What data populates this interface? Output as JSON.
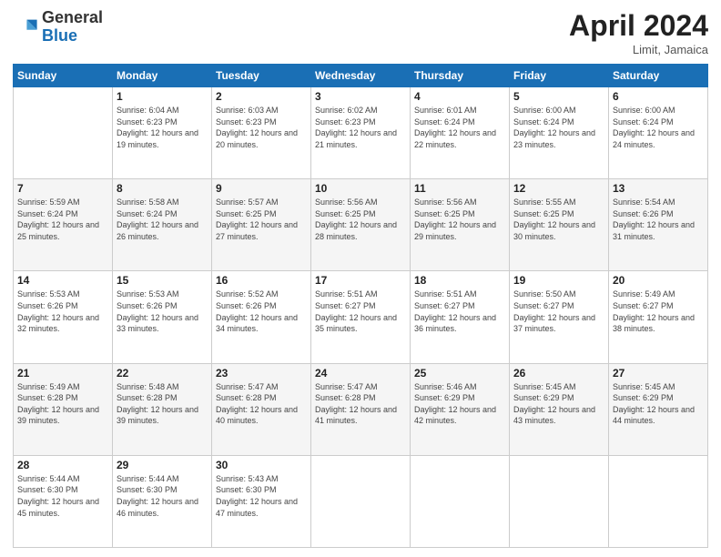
{
  "header": {
    "logo_general": "General",
    "logo_blue": "Blue",
    "month_title": "April 2024",
    "location": "Limit, Jamaica"
  },
  "weekdays": [
    "Sunday",
    "Monday",
    "Tuesday",
    "Wednesday",
    "Thursday",
    "Friday",
    "Saturday"
  ],
  "weeks": [
    [
      {
        "num": "",
        "sunrise": "",
        "sunset": "",
        "daylight": ""
      },
      {
        "num": "1",
        "sunrise": "Sunrise: 6:04 AM",
        "sunset": "Sunset: 6:23 PM",
        "daylight": "Daylight: 12 hours and 19 minutes."
      },
      {
        "num": "2",
        "sunrise": "Sunrise: 6:03 AM",
        "sunset": "Sunset: 6:23 PM",
        "daylight": "Daylight: 12 hours and 20 minutes."
      },
      {
        "num": "3",
        "sunrise": "Sunrise: 6:02 AM",
        "sunset": "Sunset: 6:23 PM",
        "daylight": "Daylight: 12 hours and 21 minutes."
      },
      {
        "num": "4",
        "sunrise": "Sunrise: 6:01 AM",
        "sunset": "Sunset: 6:24 PM",
        "daylight": "Daylight: 12 hours and 22 minutes."
      },
      {
        "num": "5",
        "sunrise": "Sunrise: 6:00 AM",
        "sunset": "Sunset: 6:24 PM",
        "daylight": "Daylight: 12 hours and 23 minutes."
      },
      {
        "num": "6",
        "sunrise": "Sunrise: 6:00 AM",
        "sunset": "Sunset: 6:24 PM",
        "daylight": "Daylight: 12 hours and 24 minutes."
      }
    ],
    [
      {
        "num": "7",
        "sunrise": "Sunrise: 5:59 AM",
        "sunset": "Sunset: 6:24 PM",
        "daylight": "Daylight: 12 hours and 25 minutes."
      },
      {
        "num": "8",
        "sunrise": "Sunrise: 5:58 AM",
        "sunset": "Sunset: 6:24 PM",
        "daylight": "Daylight: 12 hours and 26 minutes."
      },
      {
        "num": "9",
        "sunrise": "Sunrise: 5:57 AM",
        "sunset": "Sunset: 6:25 PM",
        "daylight": "Daylight: 12 hours and 27 minutes."
      },
      {
        "num": "10",
        "sunrise": "Sunrise: 5:56 AM",
        "sunset": "Sunset: 6:25 PM",
        "daylight": "Daylight: 12 hours and 28 minutes."
      },
      {
        "num": "11",
        "sunrise": "Sunrise: 5:56 AM",
        "sunset": "Sunset: 6:25 PM",
        "daylight": "Daylight: 12 hours and 29 minutes."
      },
      {
        "num": "12",
        "sunrise": "Sunrise: 5:55 AM",
        "sunset": "Sunset: 6:25 PM",
        "daylight": "Daylight: 12 hours and 30 minutes."
      },
      {
        "num": "13",
        "sunrise": "Sunrise: 5:54 AM",
        "sunset": "Sunset: 6:26 PM",
        "daylight": "Daylight: 12 hours and 31 minutes."
      }
    ],
    [
      {
        "num": "14",
        "sunrise": "Sunrise: 5:53 AM",
        "sunset": "Sunset: 6:26 PM",
        "daylight": "Daylight: 12 hours and 32 minutes."
      },
      {
        "num": "15",
        "sunrise": "Sunrise: 5:53 AM",
        "sunset": "Sunset: 6:26 PM",
        "daylight": "Daylight: 12 hours and 33 minutes."
      },
      {
        "num": "16",
        "sunrise": "Sunrise: 5:52 AM",
        "sunset": "Sunset: 6:26 PM",
        "daylight": "Daylight: 12 hours and 34 minutes."
      },
      {
        "num": "17",
        "sunrise": "Sunrise: 5:51 AM",
        "sunset": "Sunset: 6:27 PM",
        "daylight": "Daylight: 12 hours and 35 minutes."
      },
      {
        "num": "18",
        "sunrise": "Sunrise: 5:51 AM",
        "sunset": "Sunset: 6:27 PM",
        "daylight": "Daylight: 12 hours and 36 minutes."
      },
      {
        "num": "19",
        "sunrise": "Sunrise: 5:50 AM",
        "sunset": "Sunset: 6:27 PM",
        "daylight": "Daylight: 12 hours and 37 minutes."
      },
      {
        "num": "20",
        "sunrise": "Sunrise: 5:49 AM",
        "sunset": "Sunset: 6:27 PM",
        "daylight": "Daylight: 12 hours and 38 minutes."
      }
    ],
    [
      {
        "num": "21",
        "sunrise": "Sunrise: 5:49 AM",
        "sunset": "Sunset: 6:28 PM",
        "daylight": "Daylight: 12 hours and 39 minutes."
      },
      {
        "num": "22",
        "sunrise": "Sunrise: 5:48 AM",
        "sunset": "Sunset: 6:28 PM",
        "daylight": "Daylight: 12 hours and 39 minutes."
      },
      {
        "num": "23",
        "sunrise": "Sunrise: 5:47 AM",
        "sunset": "Sunset: 6:28 PM",
        "daylight": "Daylight: 12 hours and 40 minutes."
      },
      {
        "num": "24",
        "sunrise": "Sunrise: 5:47 AM",
        "sunset": "Sunset: 6:28 PM",
        "daylight": "Daylight: 12 hours and 41 minutes."
      },
      {
        "num": "25",
        "sunrise": "Sunrise: 5:46 AM",
        "sunset": "Sunset: 6:29 PM",
        "daylight": "Daylight: 12 hours and 42 minutes."
      },
      {
        "num": "26",
        "sunrise": "Sunrise: 5:45 AM",
        "sunset": "Sunset: 6:29 PM",
        "daylight": "Daylight: 12 hours and 43 minutes."
      },
      {
        "num": "27",
        "sunrise": "Sunrise: 5:45 AM",
        "sunset": "Sunset: 6:29 PM",
        "daylight": "Daylight: 12 hours and 44 minutes."
      }
    ],
    [
      {
        "num": "28",
        "sunrise": "Sunrise: 5:44 AM",
        "sunset": "Sunset: 6:30 PM",
        "daylight": "Daylight: 12 hours and 45 minutes."
      },
      {
        "num": "29",
        "sunrise": "Sunrise: 5:44 AM",
        "sunset": "Sunset: 6:30 PM",
        "daylight": "Daylight: 12 hours and 46 minutes."
      },
      {
        "num": "30",
        "sunrise": "Sunrise: 5:43 AM",
        "sunset": "Sunset: 6:30 PM",
        "daylight": "Daylight: 12 hours and 47 minutes."
      },
      {
        "num": "",
        "sunrise": "",
        "sunset": "",
        "daylight": ""
      },
      {
        "num": "",
        "sunrise": "",
        "sunset": "",
        "daylight": ""
      },
      {
        "num": "",
        "sunrise": "",
        "sunset": "",
        "daylight": ""
      },
      {
        "num": "",
        "sunrise": "",
        "sunset": "",
        "daylight": ""
      }
    ]
  ]
}
